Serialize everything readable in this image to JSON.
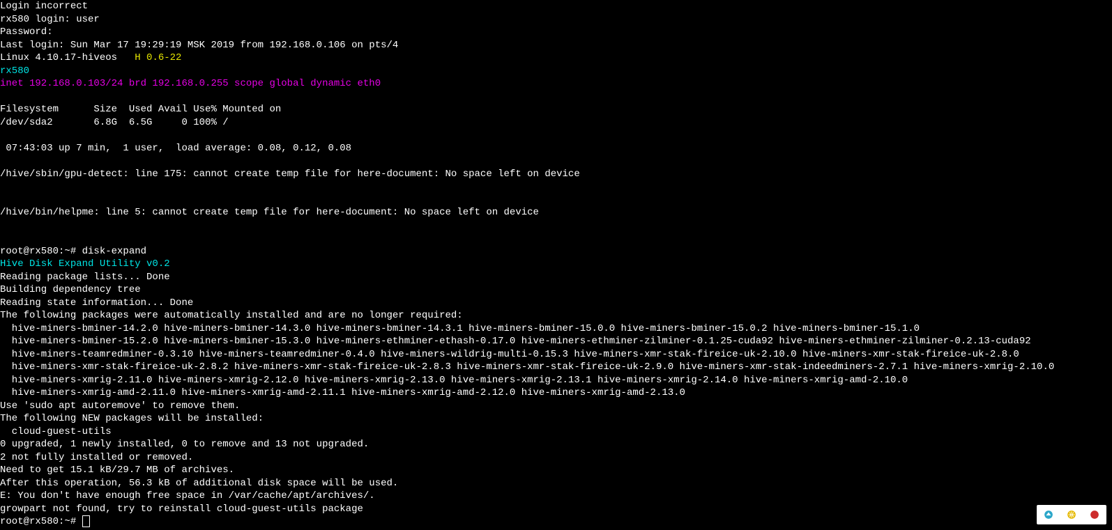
{
  "lines": {
    "l0": "Login incorrect",
    "l1": "rx580 login: user",
    "l2": "Password:",
    "l3": "Last login: Sun Mar 17 19:29:19 MSK 2019 from 192.168.0.106 on pts/4",
    "l4a": "Linux 4.10.17-hiveos   ",
    "l4b": "H 0.6-22",
    "l5": "rx580",
    "l6": "inet 192.168.0.103/24 brd 192.168.0.255 scope global dynamic eth0",
    "l7": "",
    "l8": "Filesystem      Size  Used Avail Use% Mounted on",
    "l9": "/dev/sda2       6.8G  6.5G     0 100% /",
    "l10": "",
    "l11": " 07:43:03 up 7 min,  1 user,  load average: 0.08, 0.12, 0.08",
    "l12": "",
    "l13": "/hive/sbin/gpu-detect: line 175: cannot create temp file for here-document: No space left on device",
    "l14": "",
    "l15": "",
    "l16": "/hive/bin/helpme: line 5: cannot create temp file for here-document: No space left on device",
    "l17": "",
    "l18": "",
    "l19": "root@rx580:~# disk-expand",
    "l20": "Hive Disk Expand Utility v0.2",
    "l21": "Reading package lists... Done",
    "l22": "Building dependency tree",
    "l23": "Reading state information... Done",
    "l24": "The following packages were automatically installed and are no longer required:",
    "l25": "  hive-miners-bminer-14.2.0 hive-miners-bminer-14.3.0 hive-miners-bminer-14.3.1 hive-miners-bminer-15.0.0 hive-miners-bminer-15.0.2 hive-miners-bminer-15.1.0",
    "l26": "  hive-miners-bminer-15.2.0 hive-miners-bminer-15.3.0 hive-miners-ethminer-ethash-0.17.0 hive-miners-ethminer-zilminer-0.1.25-cuda92 hive-miners-ethminer-zilminer-0.2.13-cuda92",
    "l27": "  hive-miners-teamredminer-0.3.10 hive-miners-teamredminer-0.4.0 hive-miners-wildrig-multi-0.15.3 hive-miners-xmr-stak-fireice-uk-2.10.0 hive-miners-xmr-stak-fireice-uk-2.8.0",
    "l28": "  hive-miners-xmr-stak-fireice-uk-2.8.2 hive-miners-xmr-stak-fireice-uk-2.8.3 hive-miners-xmr-stak-fireice-uk-2.9.0 hive-miners-xmr-stak-indeedminers-2.7.1 hive-miners-xmrig-2.10.0",
    "l29": "  hive-miners-xmrig-2.11.0 hive-miners-xmrig-2.12.0 hive-miners-xmrig-2.13.0 hive-miners-xmrig-2.13.1 hive-miners-xmrig-2.14.0 hive-miners-xmrig-amd-2.10.0",
    "l30": "  hive-miners-xmrig-amd-2.11.0 hive-miners-xmrig-amd-2.11.1 hive-miners-xmrig-amd-2.12.0 hive-miners-xmrig-amd-2.13.0",
    "l31": "Use 'sudo apt autoremove' to remove them.",
    "l32": "The following NEW packages will be installed:",
    "l33": "  cloud-guest-utils",
    "l34": "0 upgraded, 1 newly installed, 0 to remove and 13 not upgraded.",
    "l35": "2 not fully installed or removed.",
    "l36": "Need to get 15.1 kB/29.7 MB of archives.",
    "l37": "After this operation, 56.3 kB of additional disk space will be used.",
    "l38": "E: You don't have enough free space in /var/cache/apt/archives/.",
    "l39": "growpart not found, try to reinstall cloud-guest-utils package",
    "l40": "root@rx580:~# "
  },
  "colors": {
    "fg": "#ffffff",
    "cyan": "#00e5e5",
    "yellow": "#e5e500",
    "magenta": "#e500e5",
    "bg": "#000000"
  }
}
